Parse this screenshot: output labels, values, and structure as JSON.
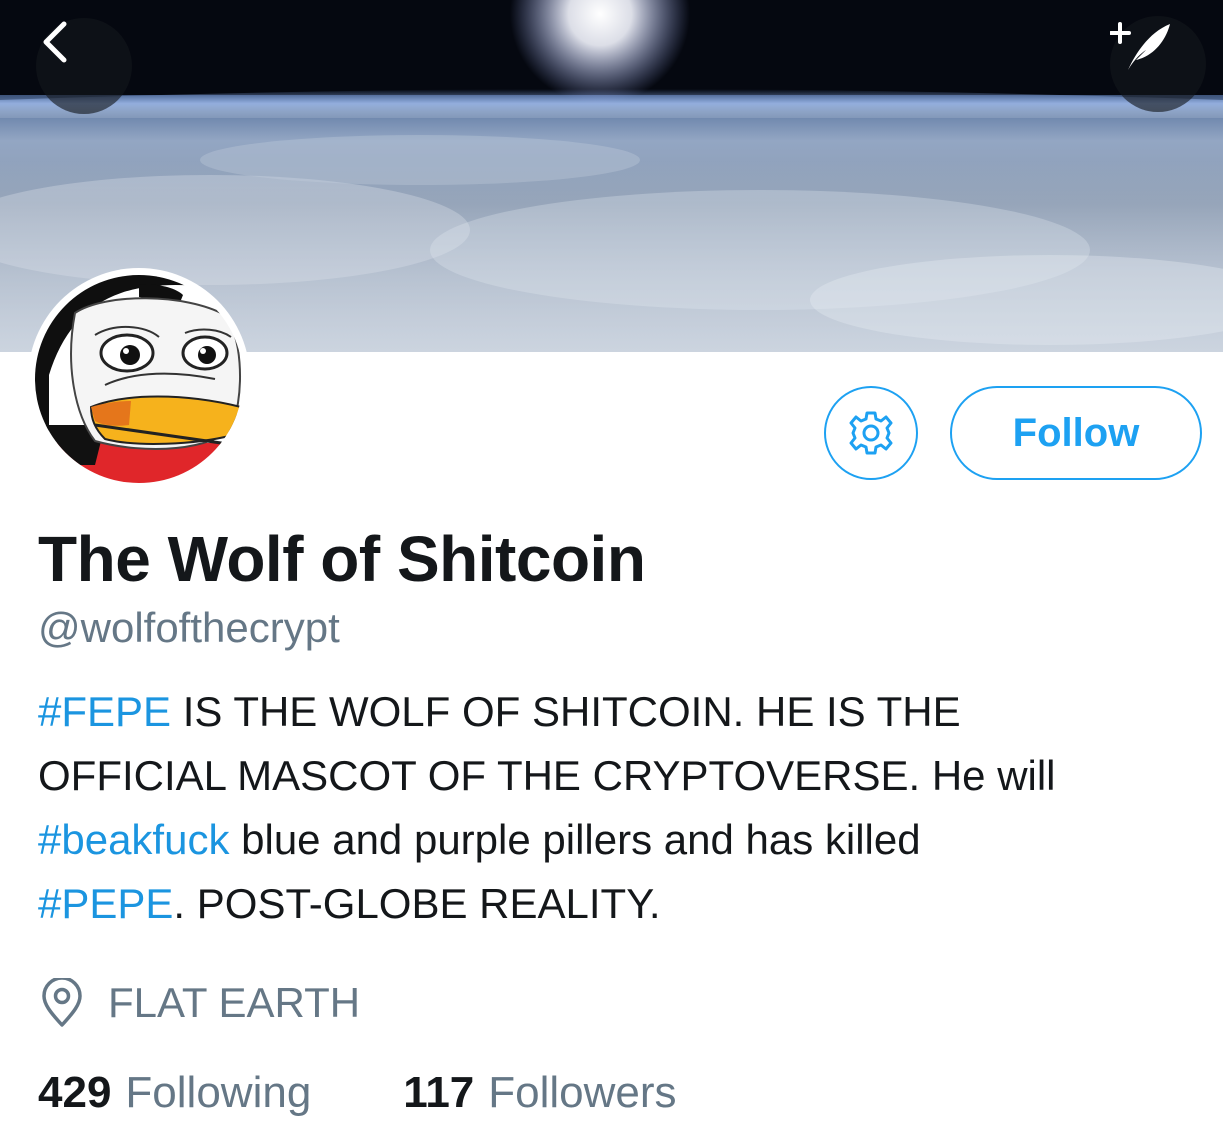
{
  "header": {
    "back_icon": "chevron-left-icon",
    "compose_icon": "compose-tweet-icon"
  },
  "profile": {
    "name": "The Wolf of Shitcoin",
    "handle": "@wolfofthecrypt",
    "follow_label": "Follow",
    "settings_icon": "gear-icon",
    "bio": {
      "line1_tag": "#FEPE",
      "line1_text": " IS THE WOLF OF SHITCOIN. HE IS THE",
      "line2_text": "OFFICIAL MASCOT OF THE CRYPTOVERSE. He will",
      "line3_tag": "#beakfuck",
      "line3_text": " blue and purple pillers and has killed",
      "line4_tag": "#PEPE",
      "line4_text": ". POST-GLOBE REALITY."
    },
    "location": "FLAT EARTH",
    "location_icon": "location-pin-icon",
    "stats": {
      "following_count": "429",
      "following_label": "Following",
      "followers_count": "117",
      "followers_label": "Followers"
    }
  },
  "colors": {
    "accent": "#1da1f2",
    "hashtag": "#1b95e0",
    "text_primary": "#14171a",
    "text_secondary": "#657786"
  }
}
